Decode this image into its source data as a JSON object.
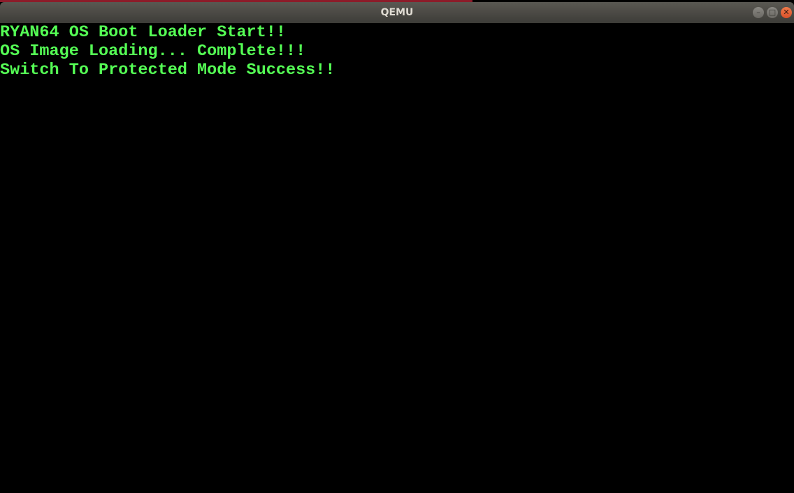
{
  "window": {
    "title": "QEMU",
    "controls": {
      "minimize": "minimize-icon",
      "maximize": "maximize-icon",
      "close": "close-icon"
    }
  },
  "console": {
    "lines": [
      "RYAN64 OS Boot Loader Start!!",
      "OS Image Loading... Complete!!!",
      "Switch To Protected Mode Success!!"
    ]
  },
  "colors": {
    "text": "#55ff55",
    "background": "#000000",
    "close": "#e95420"
  }
}
